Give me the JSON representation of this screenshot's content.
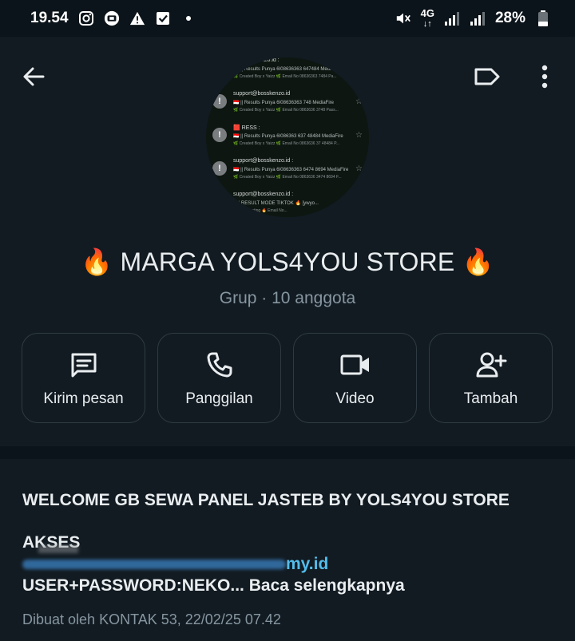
{
  "status_bar": {
    "time": "19.54",
    "network": "4G",
    "battery": "28%"
  },
  "header": {
    "back_icon": "arrow-left-icon",
    "label_icon": "label-icon",
    "more_icon": "more-vertical-icon"
  },
  "avatar": {
    "rows": [
      {
        "line1": "...@bosskenzo.id  :",
        "line2": "🇮🇩 || Results Punya 6I08636363 647484 MediaFire",
        "line3": "🌿 Created Boy x Yaizz 🌿 Email No 08636363 7484 Pa..."
      },
      {
        "line1": "support@bosskenzo.id",
        "line2": "🇮🇩 || Results Punya 6I08636363 748 MediaFire",
        "line3": "🌿 Created Boy x Yaizz 🌿 Email No 0863636 3748 Pass..."
      },
      {
        "line1": "🟥 RESS  :",
        "line2": "🇮🇩 || Results Punya 6I086363 637 48484 MediaFire",
        "line3": "🌿 Created Boy x Yaizz 🌿 Email No 0863636 37 48484 P..."
      },
      {
        "line1": "support@bosskenzo.id  :",
        "line2": "🇮🇩 || Results Punya 6I08636363 6474 8694 MediaFire",
        "line3": "🌿 Created Boy x Yaizz 🌿 Email No 0863636 3474 8694 F..."
      },
      {
        "line1": "support@bosskenzo.id  :",
        "line2": "...!| RESULT MODE TIKTOK 🔥 [ywyo...",
        "line3": "...Nasa Hosting 🔥 Email No..."
      }
    ]
  },
  "group": {
    "title": "🔥 MARGA YOLS4YOU STORE 🔥",
    "subtitle": "Grup · 10 anggota"
  },
  "actions": [
    {
      "label": "Kirim pesan",
      "icon": "message-icon"
    },
    {
      "label": "Panggilan",
      "icon": "phone-icon"
    },
    {
      "label": "Video",
      "icon": "video-camera-icon"
    },
    {
      "label": "Tambah",
      "icon": "add-person-icon"
    }
  ],
  "description": {
    "title": "WELCOME GB SEWA PANEL JASTEB BY YOLS4YOU STORE",
    "akses_label": "AKSES",
    "link_suffix": "my.id",
    "userpass": "USER+PASSWORD:NEKO...",
    "read_more": "Baca selengkapnya",
    "created": "Dibuat oleh KONTAK 53, 22/02/25 07.42"
  },
  "colors": {
    "background": "#0b141a",
    "panel": "#121b22",
    "link": "#53bdeb",
    "muted": "#8696a0"
  }
}
